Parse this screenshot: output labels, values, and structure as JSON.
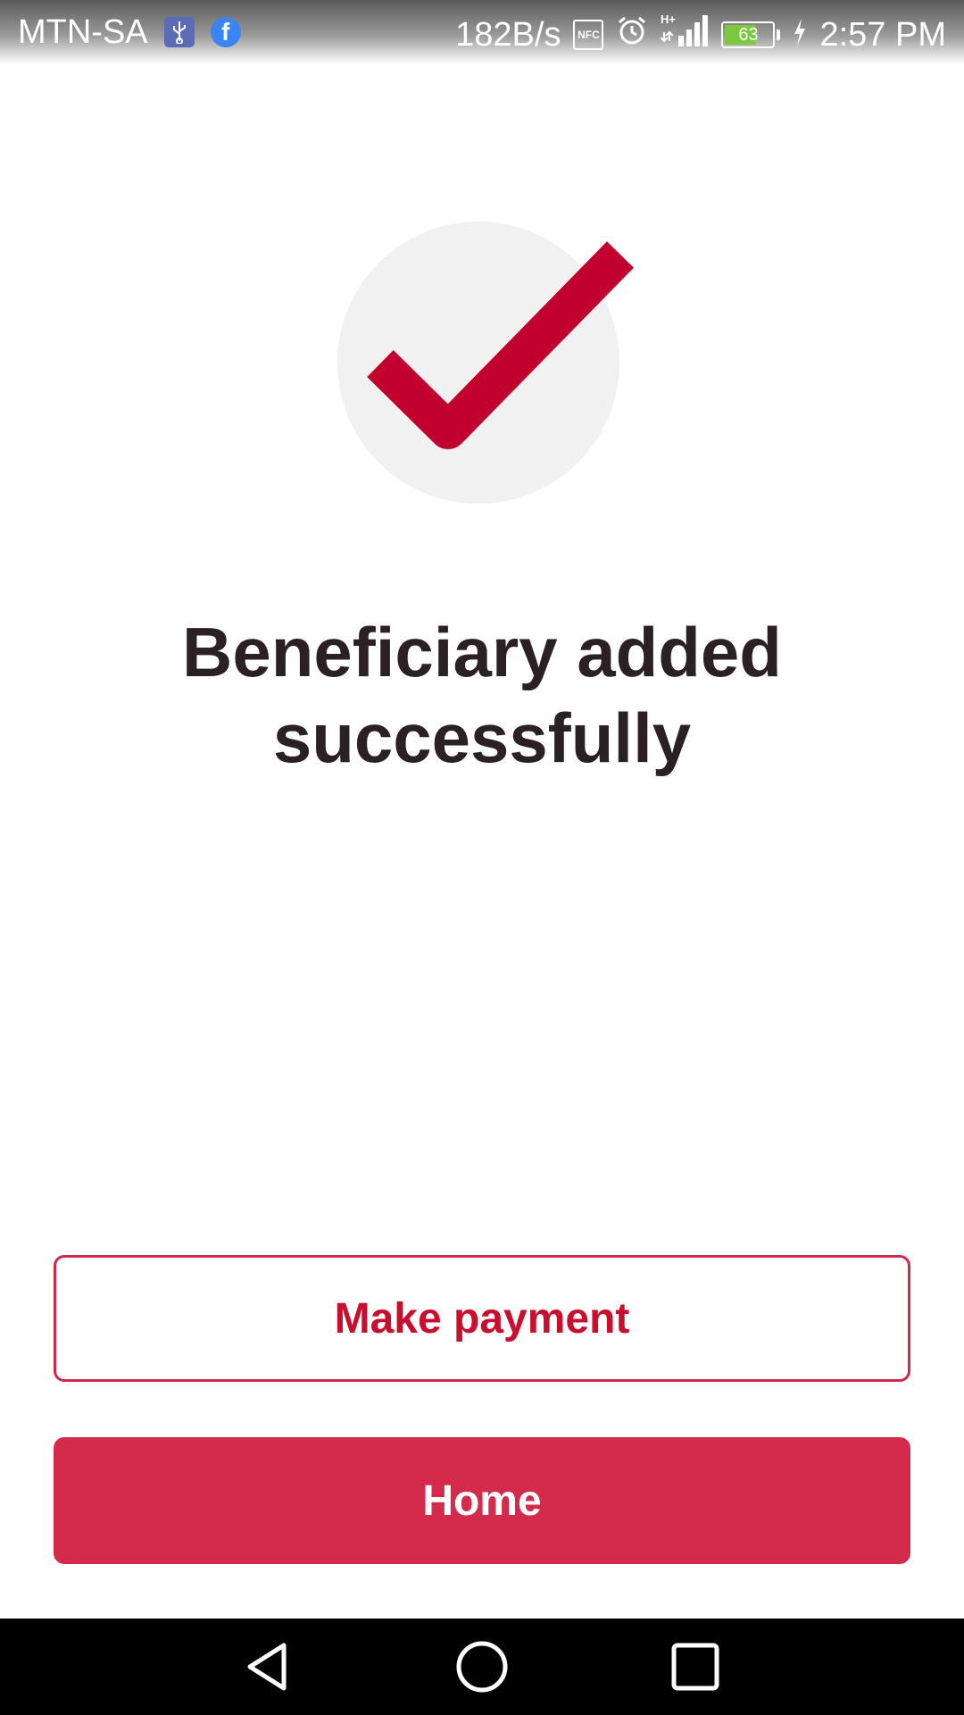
{
  "status_bar": {
    "carrier": "MTN-SA",
    "data_rate": "182B/s",
    "nfc_label": "NFC",
    "network_type": "H+",
    "battery_level": "63",
    "time": "2:57 PM",
    "icons": [
      "usb-icon",
      "facebook-icon",
      "nfc-icon",
      "alarm-icon",
      "signal-icon",
      "battery-icon",
      "charging-icon"
    ]
  },
  "success": {
    "icon": "checkmark-icon",
    "title": "Beneficiary added successfully"
  },
  "actions": {
    "make_payment_label": "Make payment",
    "home_label": "Home"
  },
  "nav_bar": {
    "icons": [
      "back-icon",
      "home-icon",
      "recents-icon"
    ]
  },
  "colors": {
    "accent": "#c8102e",
    "button_fill": "#d42a4b",
    "title_text": "#2b2124",
    "check_circle": "#f1f1f1"
  }
}
